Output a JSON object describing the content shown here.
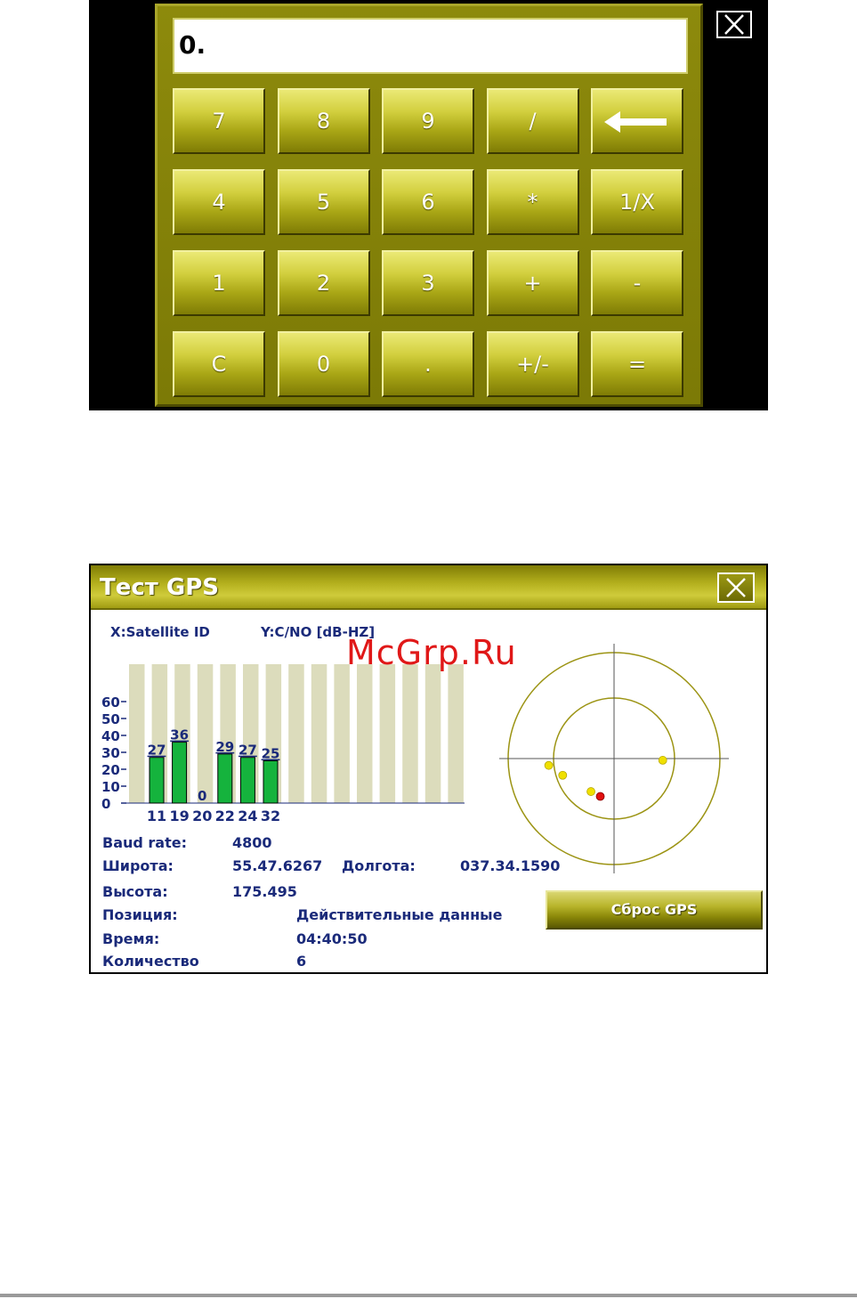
{
  "calculator": {
    "display": "0.",
    "keys": [
      [
        "7",
        "8",
        "9",
        "/",
        ""
      ],
      [
        "4",
        "5",
        "6",
        "*",
        "1/X"
      ],
      [
        "1",
        "2",
        "3",
        "+",
        "-"
      ],
      [
        "C",
        "0",
        ".",
        "+/-",
        "="
      ]
    ],
    "backspace_icon": "left-arrow-icon",
    "close_icon": "close-icon"
  },
  "gps": {
    "title": "Тест GPS",
    "close_icon": "close-icon",
    "watermark": "McGrp.Ru",
    "x_axis_label": "X:Satellite ID",
    "y_axis_label": "Y:C/NO [dB-HZ]",
    "info": {
      "baud_label": "Baud rate:",
      "baud_value": "4800",
      "lat_label": "Широта:",
      "lat_value": "55.47.6267",
      "lon_label": "Долгота:",
      "lon_value": "037.34.1590",
      "alt_label": "Высота:",
      "alt_value": "175.495",
      "pos_label": "Позиция:",
      "pos_value": "Действительные данные",
      "time_label": "Время:",
      "time_value": "04:40:50",
      "count_label": "Количество",
      "count_value": "6"
    },
    "reset_button": "Сброс GPS",
    "colors": {
      "bar": "#15b33d",
      "slot": "#dcdcbc",
      "sky_ring": "#9c9414",
      "sat_yellow": "#f0e000",
      "sat_red": "#e01010"
    },
    "sky_satellites": [
      {
        "az": 264,
        "el_frac": 0.62,
        "color": "yellow"
      },
      {
        "az": 252,
        "el_frac": 0.51,
        "color": "yellow"
      },
      {
        "az": 92,
        "el_frac": 0.46,
        "color": "yellow"
      },
      {
        "az": 215,
        "el_frac": 0.38,
        "color": "yellow"
      },
      {
        "az": 200,
        "el_frac": 0.38,
        "color": "red"
      }
    ]
  },
  "chart_data": {
    "type": "bar",
    "title": "",
    "xlabel": "X:Satellite ID",
    "ylabel": "Y:C/NO [dB-HZ]",
    "categories": [
      "11",
      "19",
      "20",
      "22",
      "24",
      "32"
    ],
    "values": [
      27,
      36,
      0,
      29,
      27,
      25
    ],
    "total_slots": 15,
    "yticks": [
      0,
      10,
      20,
      30,
      40,
      50,
      60
    ],
    "ylim": [
      0,
      66
    ],
    "grid": false,
    "legend": "none"
  }
}
